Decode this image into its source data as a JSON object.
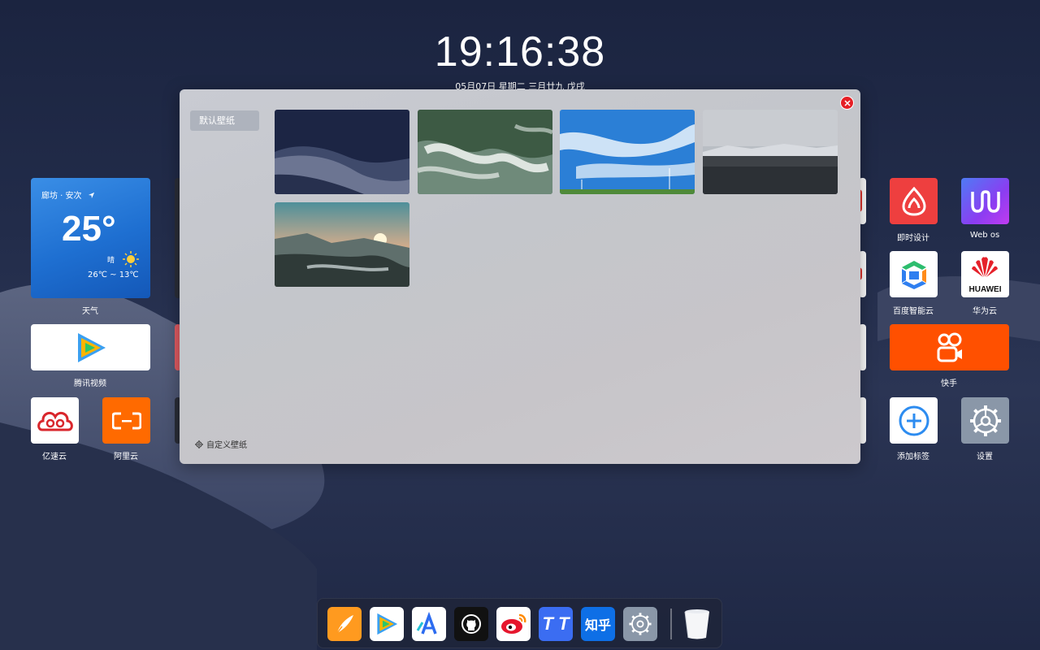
{
  "clock": {
    "time": "19:16:38",
    "date": "05月07日  星期二  三月廿九 戊戌"
  },
  "weather": {
    "location": "廊坊 · 安次",
    "temperature": "25°",
    "condition": "晴",
    "range": "26℃ ~ 13℃",
    "label": "天气"
  },
  "left_apps": [
    {
      "label": "腾讯视频",
      "icon": "tencent-video-icon"
    },
    {
      "label": "亿速云",
      "icon": "yisu-cloud-icon"
    },
    {
      "label": "阿里云",
      "icon": "aliyun-icon"
    }
  ],
  "right_apps": [
    {
      "label": "即时设计",
      "icon": "jishi-design-icon"
    },
    {
      "label": "Web os",
      "icon": "webos-icon"
    },
    {
      "label": "百度智能云",
      "icon": "baidu-cloud-icon"
    },
    {
      "label": "华为云",
      "icon": "huawei-cloud-icon",
      "logo_text": "HUAWEI"
    },
    {
      "label": "快手",
      "icon": "kuaishou-icon"
    },
    {
      "label": "添加标签",
      "icon": "add-tag-icon"
    },
    {
      "label": "设置",
      "icon": "settings-gear-icon"
    }
  ],
  "wallpaper_modal": {
    "tab": "默认壁纸",
    "custom_label": "自定义壁纸",
    "close_icon": "close-icon",
    "wallpapers": [
      "desert-dunes",
      "ocean-waves",
      "blue-sky-windmills",
      "mountain-lake",
      "sunset-valley"
    ]
  },
  "dock": {
    "items": [
      "writing-app-icon",
      "tencent-video-icon",
      "translate-app-icon",
      "github-icon",
      "weibo-icon",
      "tt-app-icon",
      "zhihu-icon",
      "settings-gear-icon"
    ],
    "zhihu_text": "知乎",
    "tt_text": "T T",
    "trash_icon": "trash-icon"
  },
  "colors": {
    "accent_close": "#e51f25",
    "kuaishou": "#ff5000",
    "weather_bg": "#1e6fd1"
  }
}
